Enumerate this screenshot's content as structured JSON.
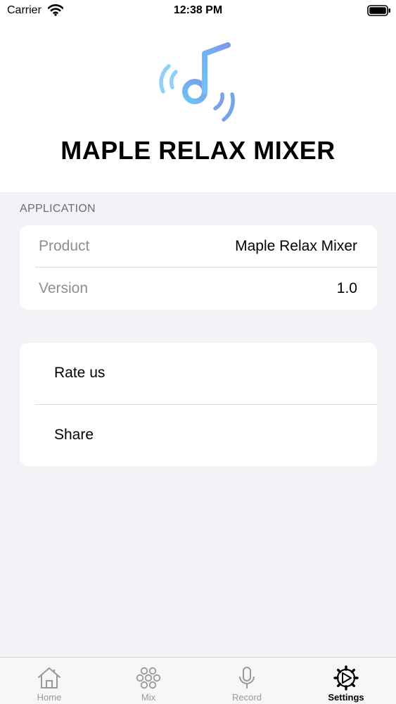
{
  "status_bar": {
    "carrier": "Carrier",
    "time": "12:38 PM"
  },
  "header": {
    "app_title": "MAPLE RELAX MIXER",
    "logo_icon": "music-note-sound-waves-icon",
    "logo_colors": [
      "#6fc3f7",
      "#7a9bea"
    ]
  },
  "application_section": {
    "label": "APPLICATION",
    "rows": [
      {
        "key": "Product",
        "value": "Maple Relax Mixer"
      },
      {
        "key": "Version",
        "value": "1.0"
      }
    ]
  },
  "actions": {
    "rate_label": "Rate us",
    "share_label": "Share"
  },
  "tabbar": {
    "tabs": [
      {
        "label": "Home",
        "icon": "home-icon",
        "active": false
      },
      {
        "label": "Mix",
        "icon": "mix-icon",
        "active": false
      },
      {
        "label": "Record",
        "icon": "microphone-icon",
        "active": false
      },
      {
        "label": "Settings",
        "icon": "settings-gear-icon",
        "active": true
      }
    ]
  }
}
